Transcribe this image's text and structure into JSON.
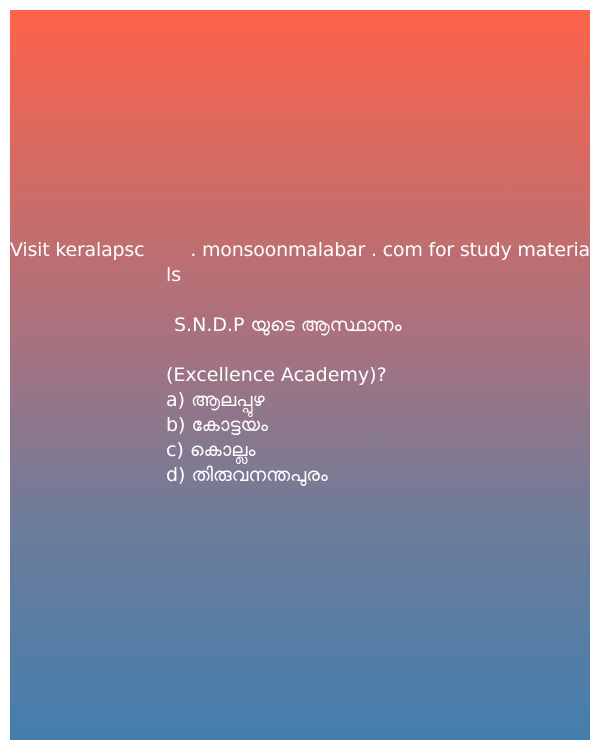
{
  "post": {
    "headline_segments": [
      "Visit keralapsc",
      ". monsoonmalabar . com for study materia"
    ],
    "headline_wrap": "ls",
    "question_line": "S.N.D.P യുടെ ആസ്ഥാനം",
    "source_line": "(Excellence Academy)?",
    "options": [
      "a) ആലപ്പുഴ",
      "b) കോട്ടയം",
      "c) കൊല്ലം",
      "d) തിരുവനന്തപുരം"
    ]
  },
  "colors": {
    "gradient_top": "#fd634a",
    "gradient_bottom": "#447ead",
    "text": "#ffffff",
    "page_background": "#ffffff"
  }
}
